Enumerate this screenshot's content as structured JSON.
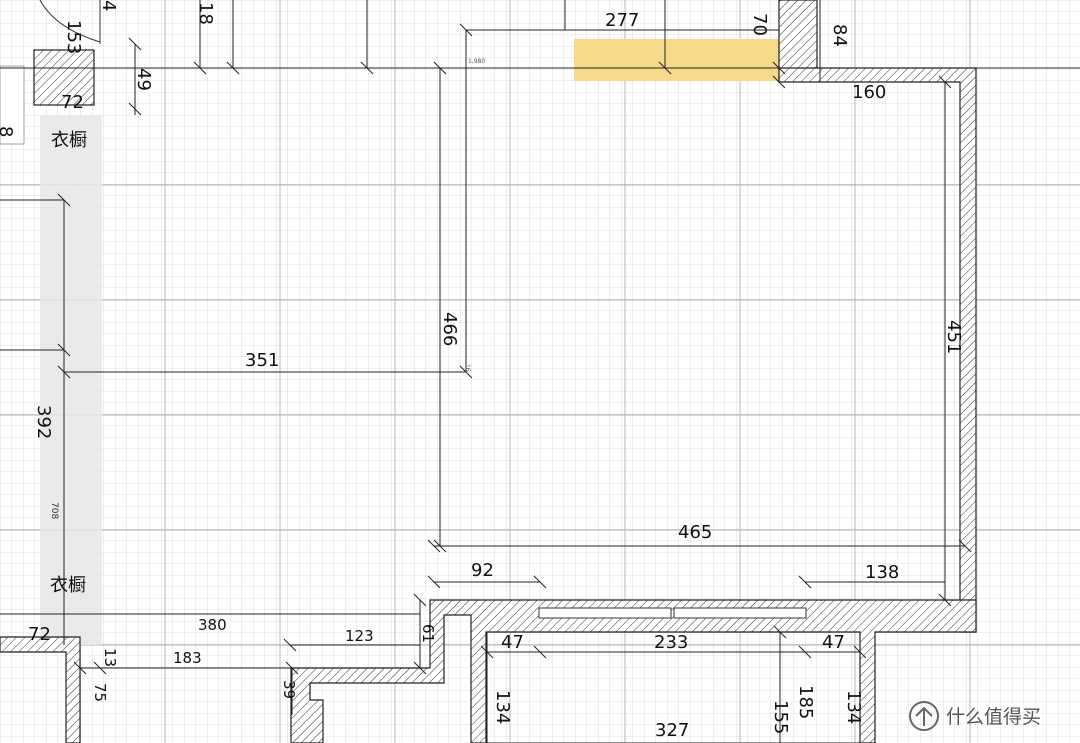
{
  "dimensions": {
    "d153": "153",
    "d4": "4",
    "d18": "18",
    "d277": "277",
    "d70": "70",
    "d84": "84",
    "d49": "49",
    "d72a": "72",
    "d8": "8",
    "d160": "160",
    "d466": "466",
    "d451": "451",
    "d351": "351",
    "d392": "392",
    "d708": "708",
    "d465": "465",
    "d92": "92",
    "d138": "138",
    "d380": "380",
    "d72b": "72",
    "d123": "123",
    "d61": "61",
    "d47a": "47",
    "d233": "233",
    "d47b": "47",
    "d183": "183",
    "d13": "13",
    "d75": "75",
    "d39": "39",
    "d134a": "134",
    "d327": "327",
    "d185": "185",
    "d155": "155",
    "d134b": "134",
    "d1980": "1,980",
    "d16": "16"
  },
  "labels": {
    "wardrobe_top": "衣橱",
    "wardrobe_bottom": "衣橱"
  },
  "watermark": {
    "icon": "zhi-badge-icon",
    "text": "什么值得买"
  },
  "colors": {
    "grid": "#d4d4d4",
    "grid_major": "#b5b5b5",
    "wall": "#222222",
    "highlight": "#f7d98a",
    "wardrobe_fill": "#e7e7e7"
  }
}
